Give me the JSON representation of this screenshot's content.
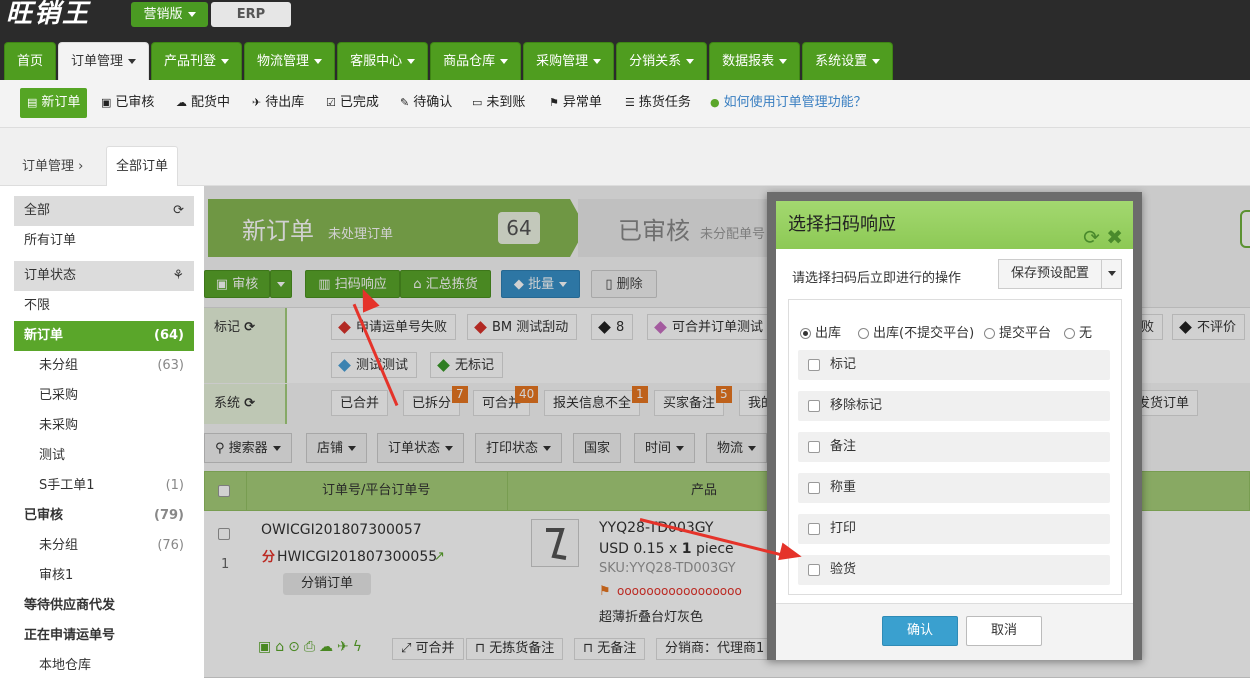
{
  "app": {
    "logo": "旺销王",
    "edition": "营销版",
    "erp": "ERP"
  },
  "nav": {
    "tabs": [
      "首页",
      "订单管理",
      "产品刊登",
      "物流管理",
      "客服中心",
      "商品仓库",
      "采购管理",
      "分销关系",
      "数据报表",
      "系统设置"
    ]
  },
  "subnav": [
    "新订单",
    "已审核",
    "配货中",
    "待出库",
    "已完成",
    "待确认",
    "未到账",
    "异常单",
    "拣货任务",
    "如何使用订单管理功能？"
  ],
  "breadcrumb": {
    "root": "订单管理",
    "current": "全部订单"
  },
  "sidebar": [
    {
      "label": "全部",
      "count": ""
    },
    {
      "label": "所有订单",
      "count": ""
    },
    {
      "label": "订单状态",
      "count": ""
    },
    {
      "label": "不限",
      "count": ""
    },
    {
      "label": "新订单",
      "count": "(64)"
    },
    {
      "label": "未分组",
      "count": "(63)"
    },
    {
      "label": "已采购",
      "count": ""
    },
    {
      "label": "未采购",
      "count": ""
    },
    {
      "label": "测试",
      "count": ""
    },
    {
      "label": "S手工单1",
      "count": "(1)"
    },
    {
      "label": "已审核",
      "count": "(79)"
    },
    {
      "label": "未分组",
      "count": "(76)"
    },
    {
      "label": "审核1",
      "count": ""
    },
    {
      "label": "等待供应商代发",
      "count": ""
    },
    {
      "label": "正在申请运单号",
      "count": ""
    },
    {
      "label": "本地仓库",
      "count": ""
    }
  ],
  "steps": {
    "s1_title": "新订单",
    "s1_sub": "未处理订单",
    "s1_count": "64",
    "s2_title": "已审核",
    "s2_sub": "未分配单号"
  },
  "actions": {
    "audit": "审核",
    "scan": "扫码响应",
    "summary": "汇总拣货",
    "batch": "批量",
    "delete": "删除"
  },
  "tags": {
    "label_mark": "标记",
    "label_sys": "系统",
    "marks": [
      "申请运单号失败",
      "BM 测试刮动",
      "8",
      "可合并订单测试",
      "失败",
      "不评价",
      "测试测试",
      "无标记"
    ],
    "mark_colors": [
      "#d9322b",
      "#d9322b",
      "#222222",
      "#c86fc2",
      "#d9322b",
      "#222222",
      "#4aa0d8",
      "#3a9a2a"
    ],
    "sys": [
      "已合并",
      "已拆分",
      "可合并",
      "报关信息不全",
      "买家备注",
      "我的",
      "未发货订单"
    ],
    "sys_badges": [
      "7",
      "40",
      "1",
      "5"
    ]
  },
  "filters": [
    "搜索器",
    "店铺",
    "订单状态",
    "打印状态",
    "国家",
    "时间",
    "物流"
  ],
  "table": {
    "col_order": "订单号/平台订单号",
    "col_product": "产品"
  },
  "order": {
    "index": "1",
    "order_no": "OWICGI201807300057",
    "platform_no": "HWICGI201807300055",
    "dist_prefix": "分",
    "dist_label": "分销订单",
    "sku_title": "YYQ28-TD003GY",
    "price": "USD 0.15 x",
    "qty": "1",
    "unit": "piece",
    "sku": "SKU:YYQ28-TD003GY",
    "flag_text": "ooooooooooooooooo",
    "name": "超薄折叠台灯灰色",
    "foot": {
      "merge": "可合并",
      "no_pick": "无拣货备注",
      "no_note": "无备注",
      "distributor": "分销商：代理商1"
    }
  },
  "dialog": {
    "title": "选择扫码响应",
    "prompt": "请选择扫码后立即进行的操作",
    "save_preset": "保存预设配置",
    "radios": [
      "出库",
      "出库(不提交平台)",
      "提交平台",
      "无"
    ],
    "options": [
      "标记",
      "移除标记",
      "备注",
      "称重",
      "打印",
      "验货"
    ],
    "confirm": "确认",
    "cancel": "取消"
  }
}
